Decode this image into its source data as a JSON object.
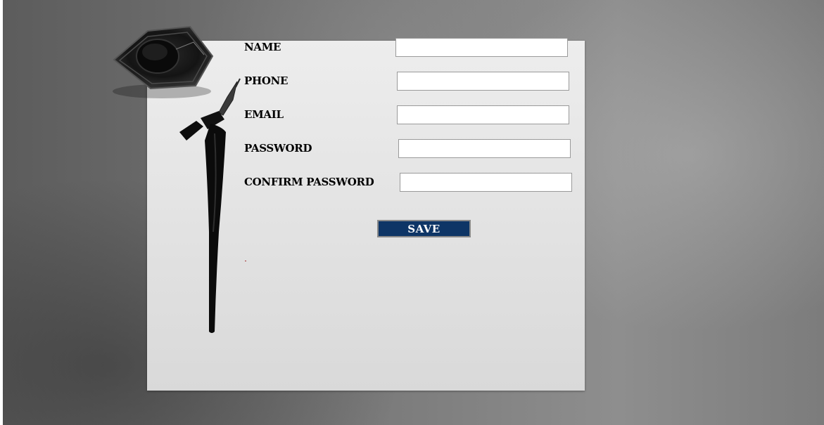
{
  "form": {
    "fields": [
      {
        "label": "NAME",
        "value": "",
        "placeholder": ""
      },
      {
        "label": "PHONE",
        "value": "",
        "placeholder": ""
      },
      {
        "label": "EMAIL",
        "value": "",
        "placeholder": ""
      },
      {
        "label": "PASSWORD",
        "value": "",
        "placeholder": ""
      },
      {
        "label": "CONFIRM PASSWORD",
        "value": "",
        "placeholder": ""
      }
    ],
    "save_label": "SAVE"
  },
  "colors": {
    "button_bg": "#0e3566",
    "button_text": "#ffffff",
    "label_text": "#000000",
    "paper": "#e4e4e4",
    "background": "#6f6f6f"
  },
  "decor": {
    "ink_pot_icon": "ink-pot-icon",
    "pen_icon": "fountain-pen-icon"
  }
}
